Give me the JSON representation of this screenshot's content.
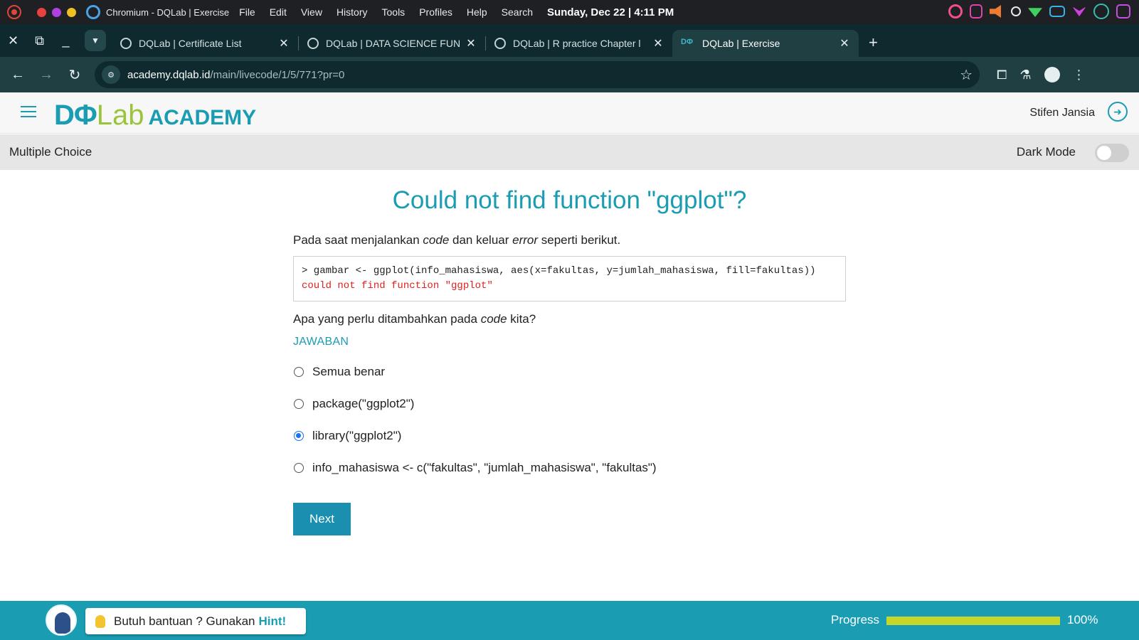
{
  "os": {
    "app_title": "Chromium - DQLab | Exercise",
    "menu": [
      "File",
      "Edit",
      "View",
      "History",
      "Tools",
      "Profiles",
      "Help",
      "Search"
    ],
    "clock": "Sunday, Dec 22 | 4:11 PM",
    "traffic_colors": [
      "#e94040",
      "#b040e0",
      "#f0c020"
    ]
  },
  "browser": {
    "tabs": [
      {
        "title": "DQLab | Certificate List",
        "active": false
      },
      {
        "title": "DQLab | DATA SCIENCE FUND",
        "active": false
      },
      {
        "title": "DQLab | R practice Chapter l",
        "active": false
      },
      {
        "title": "DQLab | Exercise",
        "active": true
      }
    ],
    "url_host": "academy.dqlab.id",
    "url_path": "/main/livecode/1/5/771?pr=0"
  },
  "site": {
    "logo_dq": "DΦ",
    "logo_lab": "Lab",
    "logo_academy": "ACADEMY",
    "user_name": "Stifen Jansia"
  },
  "subheader": {
    "title": "Multiple Choice",
    "dark_mode_label": "Dark Mode",
    "dark_mode_on": false
  },
  "exercise": {
    "title": "Could not find function \"ggplot\"?",
    "intro_parts": [
      "Pada saat menjalankan ",
      "code",
      " dan keluar ",
      "error",
      " seperti berikut."
    ],
    "code_line": "> gambar <- ggplot(info_mahasiswa, aes(x=fakultas, y=jumlah_mahasiswa, fill=fakultas))",
    "code_error": "could not find function \"ggplot\"",
    "question_parts": [
      "Apa yang perlu ditambahkan pada ",
      "code",
      " kita?"
    ],
    "answer_label": "JAWABAN",
    "options": [
      {
        "label": "Semua benar",
        "selected": false
      },
      {
        "label": "package(\"ggplot2\")",
        "selected": false
      },
      {
        "label": "library(\"ggplot2\")",
        "selected": true
      },
      {
        "label": "info_mahasiswa <- c(\"fakultas\", \"jumlah_mahasiswa\", \"fakultas\")",
        "selected": false
      }
    ],
    "next_label": "Next"
  },
  "footer": {
    "hint_text": "Butuh bantuan ? Gunakan",
    "hint_link": "Hint!",
    "progress_label": "Progress",
    "progress_value": 100,
    "progress_text": "100%"
  }
}
